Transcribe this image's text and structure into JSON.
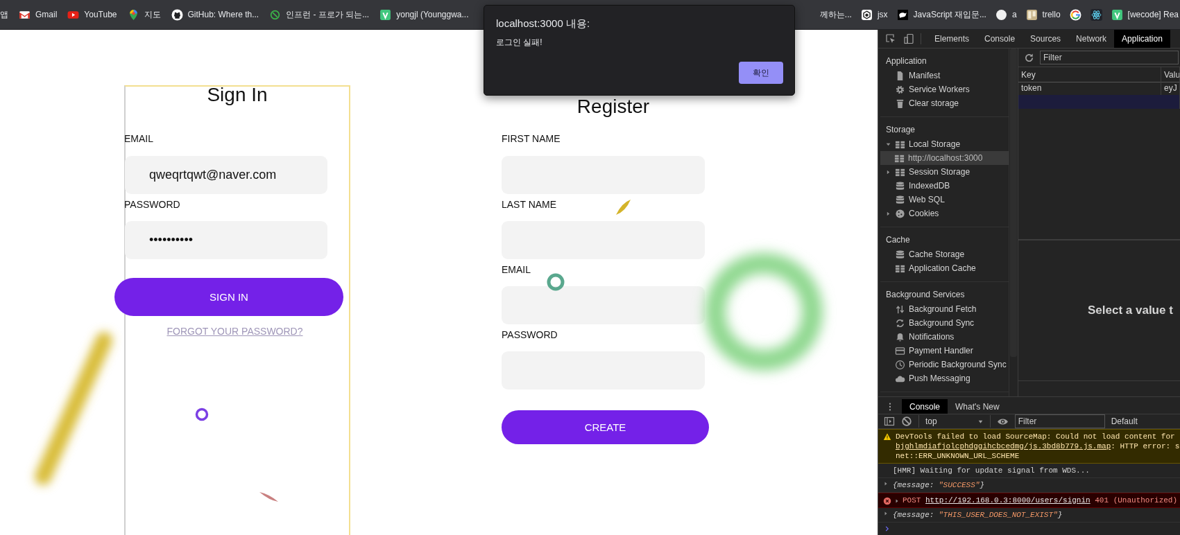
{
  "bookmarks_bar": {
    "left": [
      {
        "label": "앱"
      },
      {
        "kind": "gmail",
        "label": "Gmail"
      },
      {
        "kind": "youtube",
        "label": "YouTube"
      },
      {
        "kind": "maps",
        "label": "지도"
      },
      {
        "kind": "github",
        "label": "GitHub: Where th..."
      },
      {
        "kind": "inflearn",
        "label": "인프런 - 프로가 되는..."
      },
      {
        "kind": "vsquare",
        "label": "yongjl (Younggwa..."
      }
    ],
    "right": [
      {
        "label": "께하는..."
      },
      {
        "kind": "hexagon",
        "label": "jsx"
      },
      {
        "kind": "animal",
        "label": "JavaScript 재입문..."
      },
      {
        "kind": "circle",
        "label": "a"
      },
      {
        "kind": "image",
        "label": "trello"
      },
      {
        "kind": "google"
      },
      {
        "kind": "atom"
      },
      {
        "kind": "vsquare",
        "label": "[wecode] Rea"
      }
    ]
  },
  "dialog": {
    "title": "localhost:3000 내용:",
    "message": "로그인 실패!",
    "button": "확인"
  },
  "sign_in": {
    "title": "Sign In",
    "fields": [
      {
        "label": "EMAIL",
        "value": "qweqrtqwt@naver.com"
      },
      {
        "label": "PASSWORD",
        "value": "••••••••••"
      }
    ],
    "button": "SIGN IN",
    "link": "FORGOT YOUR PASSWORD?"
  },
  "register": {
    "title": "Register",
    "fields": [
      {
        "label": "FIRST NAME"
      },
      {
        "label": "LAST NAME"
      },
      {
        "label": "EMAIL"
      },
      {
        "label": "PASSWORD"
      }
    ],
    "button": "CREATE"
  },
  "devtools": {
    "tabs": [
      {
        "label": "Elements",
        "selected": false
      },
      {
        "label": "Console",
        "selected": false
      },
      {
        "label": "Sources",
        "selected": false
      },
      {
        "label": "Network",
        "selected": false
      },
      {
        "label": "Application",
        "selected": true
      }
    ],
    "sidebar": [
      {
        "heading": "Application",
        "items": [
          {
            "kind": "file",
            "label": "Manifest",
            "selected": false
          },
          {
            "kind": "gear",
            "label": "Service Workers",
            "selected": false
          },
          {
            "kind": "trash",
            "label": "Clear storage",
            "selected": false
          }
        ]
      },
      {
        "heading": "Storage",
        "items": [
          {
            "kind": "grid",
            "label": "Local Storage",
            "selected": false,
            "expanded": true,
            "children": [
              {
                "kind": "grid",
                "label": "http://localhost:3000",
                "selected": true
              }
            ]
          },
          {
            "kind": "grid",
            "label": "Session Storage",
            "selected": false,
            "expanded": false
          },
          {
            "kind": "database",
            "label": "IndexedDB",
            "selected": false
          },
          {
            "kind": "database",
            "label": "Web SQL",
            "selected": false
          },
          {
            "kind": "cookie",
            "label": "Cookies",
            "selected": false,
            "expanded": false
          }
        ]
      },
      {
        "heading": "Cache",
        "items": [
          {
            "kind": "database",
            "label": "Cache Storage",
            "selected": false
          },
          {
            "kind": "grid",
            "label": "Application Cache",
            "selected": false
          }
        ]
      },
      {
        "heading": "Background Services",
        "items": [
          {
            "kind": "arrows",
            "label": "Background Fetch",
            "selected": false
          },
          {
            "kind": "sync",
            "label": "Background Sync",
            "selected": false
          },
          {
            "kind": "bell",
            "label": "Notifications",
            "selected": false
          },
          {
            "kind": "card",
            "label": "Payment Handler",
            "selected": false
          },
          {
            "kind": "clock",
            "label": "Periodic Background Sync",
            "selected": false
          },
          {
            "kind": "cloud",
            "label": "Push Messaging",
            "selected": false
          }
        ]
      }
    ],
    "filter": {
      "placeholder": "Filter"
    },
    "table": {
      "columns": [
        "Key",
        "Valu"
      ],
      "rows": [
        {
          "cells": [
            "token",
            "eyJ"
          ],
          "selected": false
        },
        {
          "cells": [],
          "selected": true
        }
      ]
    },
    "preview": "Select a value t",
    "drawer_tabs": [
      {
        "label": "Console",
        "selected": true
      },
      {
        "label": "What's New",
        "selected": false
      }
    ],
    "console_toolbar": {
      "context": "top",
      "filter_placeholder": "Filter",
      "levels": "Default"
    },
    "messages": [
      {
        "kind": "warning",
        "parts": [
          {
            "text": "DevTools failed to load SourceMap: Could not load content for\n"
          },
          {
            "text": "bjghlmdiafjolcphdggihcbcedmg/js.3bd8b779.js.map",
            "kind": "link"
          },
          {
            "text": ": HTTP error: s\nnet::ERR_UNKNOWN_URL_SCHEME"
          }
        ]
      },
      {
        "kind": "log",
        "parts": [
          {
            "text": "[HMR] Waiting for update signal from WDS..."
          }
        ]
      },
      {
        "kind": "object",
        "parts": [
          {
            "text": "{message: "
          },
          {
            "text": "\"SUCCESS\"",
            "kind": "string"
          },
          {
            "text": "}"
          }
        ]
      },
      {
        "kind": "error",
        "parts": [
          {
            "text": "POST "
          },
          {
            "text": "http://192.168.0.3:8000/users/signin",
            "kind": "link"
          },
          {
            "text": " 401 (Unauthorized)"
          }
        ]
      },
      {
        "kind": "object",
        "parts": [
          {
            "text": "{message: "
          },
          {
            "text": "\"THIS_USER_DOES_NOT_EXIST\"",
            "kind": "string"
          },
          {
            "text": "}"
          }
        ]
      }
    ]
  }
}
